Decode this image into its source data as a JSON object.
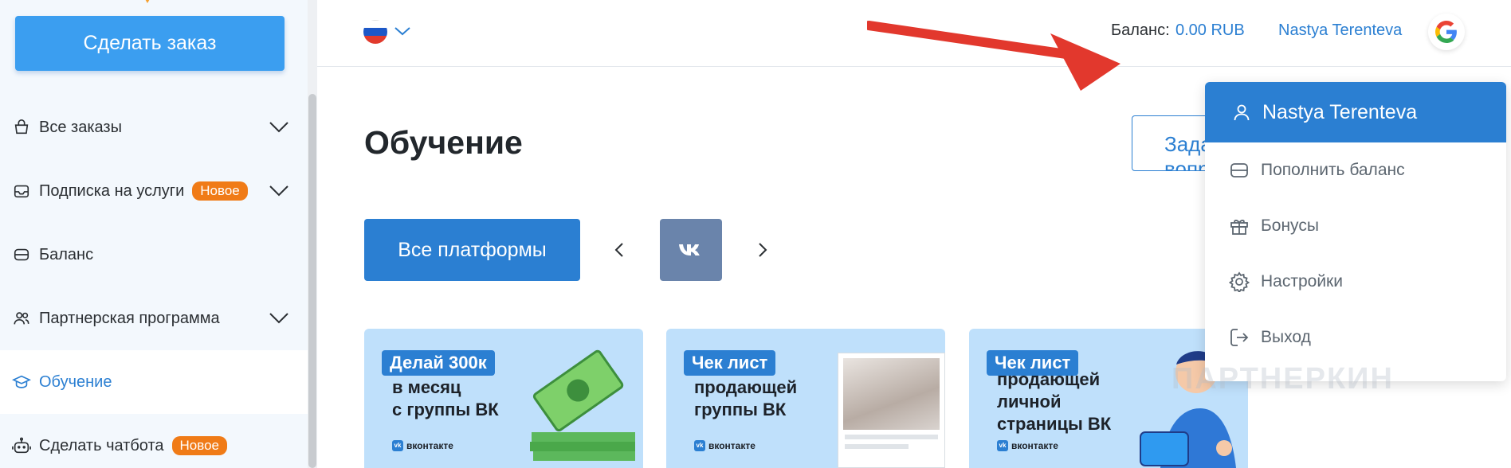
{
  "sidebar": {
    "order_button": "Сделать заказ",
    "items": [
      {
        "label": "Все заказы"
      },
      {
        "label": "Подписка на услуги",
        "badge": "Новое"
      },
      {
        "label": "Баланс"
      },
      {
        "label": "Партнерская программа"
      },
      {
        "label": "Обучение"
      },
      {
        "label": "Сделать чатбота",
        "badge": "Новое"
      }
    ]
  },
  "header": {
    "language_flag": "ru-flag-icon",
    "balance_label": "Баланс:",
    "balance_value": "0.00 RUB",
    "user_name": "Nastya Terenteva",
    "auth_icon": "google-icon"
  },
  "main": {
    "title": "Обучение",
    "task_button": "Задать вопрос",
    "platforms_button": "Все платформы",
    "vk_tile": "vk",
    "cards": [
      {
        "tag": "Делай 300к",
        "lines": [
          "в месяц",
          "с группы ВК"
        ],
        "brand": "вконтакте"
      },
      {
        "tag": "Чек лист",
        "lines": [
          "продающей",
          "группы ВК"
        ],
        "brand": "вконтакте"
      },
      {
        "tag": "Чек лист",
        "lines": [
          "продающей",
          "личной",
          "страницы ВК"
        ],
        "brand": "вконтакте"
      }
    ]
  },
  "dropdown": {
    "user_name": "Nastya Terenteva",
    "items": [
      {
        "label": "Пополнить баланс",
        "icon": "wallet-icon"
      },
      {
        "label": "Бонусы",
        "icon": "gift-icon"
      },
      {
        "label": "Настройки",
        "icon": "gear-icon"
      },
      {
        "label": "Выход",
        "icon": "logout-icon"
      }
    ]
  },
  "watermark": "ПАРТНЕРКИН",
  "colors": {
    "accent": "#2b7fd2",
    "badge": "#f07b17",
    "arrow": "#e2382d",
    "sidebar_bg": "#f3f8fd"
  }
}
